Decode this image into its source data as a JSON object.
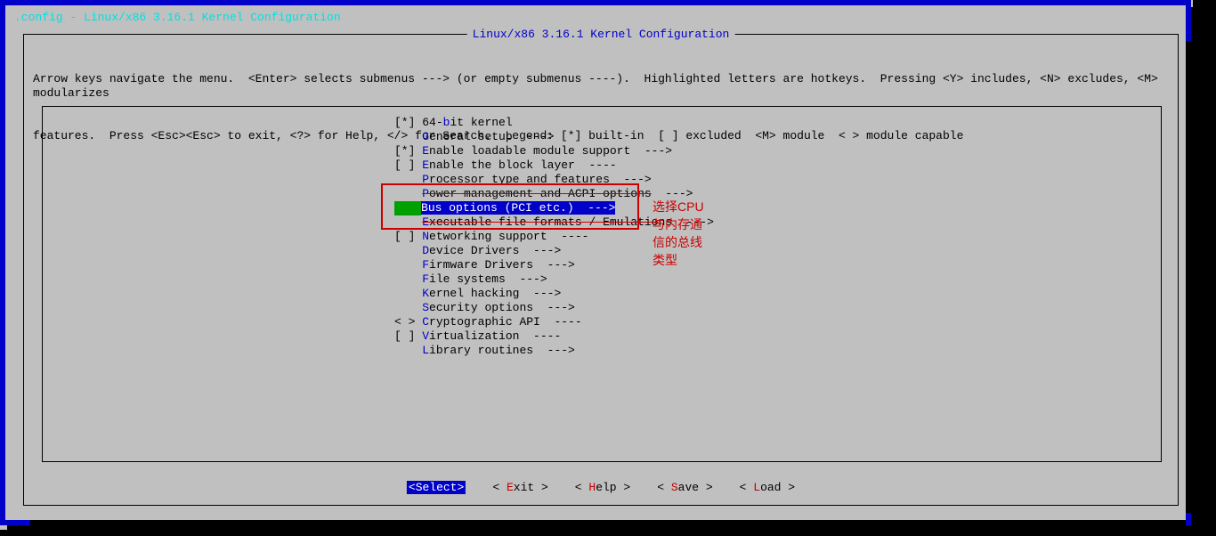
{
  "window_title": ".config - Linux/x86 3.16.1 Kernel Configuration",
  "inner_title": "Linux/x86 3.16.1 Kernel Configuration",
  "help_line1": "Arrow keys navigate the menu.  <Enter> selects submenus ---> (or empty submenus ----).  Highlighted letters are hotkeys.  Pressing <Y> includes, <N> excludes, <M> modularizes",
  "help_line2": "features.  Press <Esc><Esc> to exit, <?> for Help, </> for Search.  Legend: [*] built-in  [ ] excluded  <M> module  < > module capable",
  "menu": [
    {
      "prefix": "[*] ",
      "hotkey": "",
      "pre": "64-",
      "hk": "b",
      "post": "it kernel",
      "suffix": ""
    },
    {
      "prefix": "    ",
      "hotkey": "",
      "pre": "",
      "hk": "G",
      "post": "eneral setup  --->",
      "suffix": ""
    },
    {
      "prefix": "[*] ",
      "hotkey": "",
      "pre": "",
      "hk": "E",
      "post": "nable loadable module support  --->",
      "suffix": ""
    },
    {
      "prefix": "[ ] ",
      "hotkey": "",
      "pre": "",
      "hk": "E",
      "post": "nable the block layer  ----",
      "suffix": ""
    },
    {
      "prefix": "    ",
      "hotkey": "",
      "pre": "",
      "hk": "P",
      "post": "rocessor type and features  --->",
      "suffix": ""
    },
    {
      "prefix": "    ",
      "hotkey": "",
      "pre": "",
      "hk": "P",
      "post": "ower management and ACPI options",
      "suffix": "  --->",
      "strike": true
    },
    {
      "prefix": "    ",
      "hotkey": "",
      "pre": "",
      "hk": "B",
      "post": "us options (PCI etc.)  --->",
      "suffix": "",
      "selected": true
    },
    {
      "prefix": "    ",
      "hotkey": "",
      "pre": "",
      "hk": "E",
      "post": "xecutable file formats / Emulatio",
      "suffix": "ns  --->",
      "strike": true
    },
    {
      "prefix": "[ ] ",
      "hotkey": "",
      "pre": "",
      "hk": "N",
      "post": "etworking support  ----",
      "suffix": ""
    },
    {
      "prefix": "    ",
      "hotkey": "",
      "pre": "",
      "hk": "D",
      "post": "evice Drivers  --->",
      "suffix": ""
    },
    {
      "prefix": "    ",
      "hotkey": "",
      "pre": "",
      "hk": "F",
      "post": "irmware Drivers  --->",
      "suffix": ""
    },
    {
      "prefix": "    ",
      "hotkey": "",
      "pre": "",
      "hk": "F",
      "post": "ile systems  --->",
      "suffix": ""
    },
    {
      "prefix": "    ",
      "hotkey": "",
      "pre": "",
      "hk": "K",
      "post": "ernel hacking  --->",
      "suffix": ""
    },
    {
      "prefix": "    ",
      "hotkey": "",
      "pre": "",
      "hk": "S",
      "post": "ecurity options  --->",
      "suffix": ""
    },
    {
      "prefix": "< > ",
      "hotkey": "",
      "pre": "",
      "hk": "C",
      "post": "ryptographic API  ----",
      "suffix": ""
    },
    {
      "prefix": "[ ] ",
      "hotkey": "",
      "pre": "",
      "hk": "V",
      "post": "irtualization  ----",
      "suffix": ""
    },
    {
      "prefix": "    ",
      "hotkey": "",
      "pre": "",
      "hk": "L",
      "post": "ibrary routines  --->",
      "suffix": ""
    }
  ],
  "annotation": "选择CPU与内存通信的总线类型",
  "buttons": {
    "select": {
      "open": "<",
      "hk": "S",
      "rest": "elect>",
      "active": true
    },
    "exit": {
      "open": "< ",
      "hk": "E",
      "rest": "xit >"
    },
    "help": {
      "open": "< ",
      "hk": "H",
      "rest": "elp >"
    },
    "save": {
      "open": "< ",
      "hk": "S",
      "rest": "ave >"
    },
    "load": {
      "open": "< ",
      "hk": "L",
      "rest": "oad >"
    }
  }
}
